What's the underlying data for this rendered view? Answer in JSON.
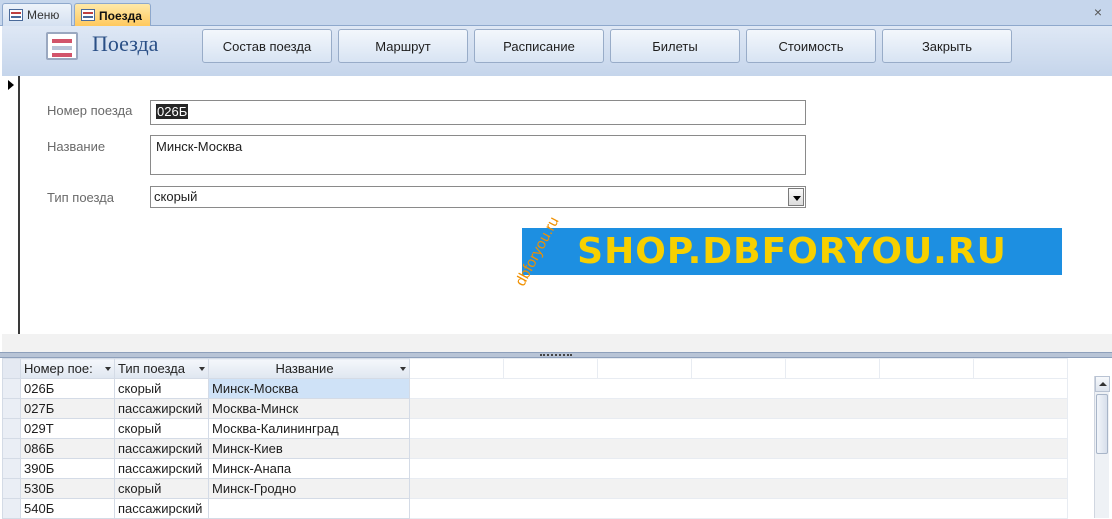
{
  "tabs": [
    {
      "label": "Меню",
      "icon": "form-icon",
      "active": false
    },
    {
      "label": "Поезда",
      "icon": "form-icon",
      "active": true
    }
  ],
  "header": {
    "title": "Поезда",
    "buttons": {
      "composition": "Состав поезда",
      "route": "Маршрут",
      "schedule": "Расписание",
      "tickets": "Билеты",
      "cost": "Стоимость",
      "close": "Закрыть"
    }
  },
  "form": {
    "train_number_label": "Номер поезда",
    "train_number_value": "026Б",
    "name_label": "Название",
    "name_value": "Минск-Москва",
    "type_label": "Тип поезда",
    "type_value": "скорый"
  },
  "watermark": {
    "banner": "SHOP.DBFORYOU.RU",
    "rotated": "dbforyou.ru"
  },
  "datasheet": {
    "columns": [
      "Номер пое:",
      "Тип поезда",
      "Название"
    ],
    "rows": [
      [
        "026Б",
        "скорый",
        "Минск-Москва"
      ],
      [
        "027Б",
        "пассажирский",
        "Москва-Минск"
      ],
      [
        "029Т",
        "скорый",
        "Москва-Калининград"
      ],
      [
        "086Б",
        "пассажирский",
        "Минск-Киев"
      ],
      [
        "390Б",
        "пассажирский",
        "Минск-Анапа"
      ],
      [
        "530Б",
        "скорый",
        "Минск-Гродно"
      ],
      [
        "540Б",
        "пассажирский",
        ""
      ]
    ]
  },
  "colors": {
    "header_bg": "#c5d5eb",
    "active_tab": "#ffc75a",
    "banner_bg": "#1d8fe1",
    "banner_text": "#f7d000",
    "selected_cell": "#cfe2f7"
  }
}
